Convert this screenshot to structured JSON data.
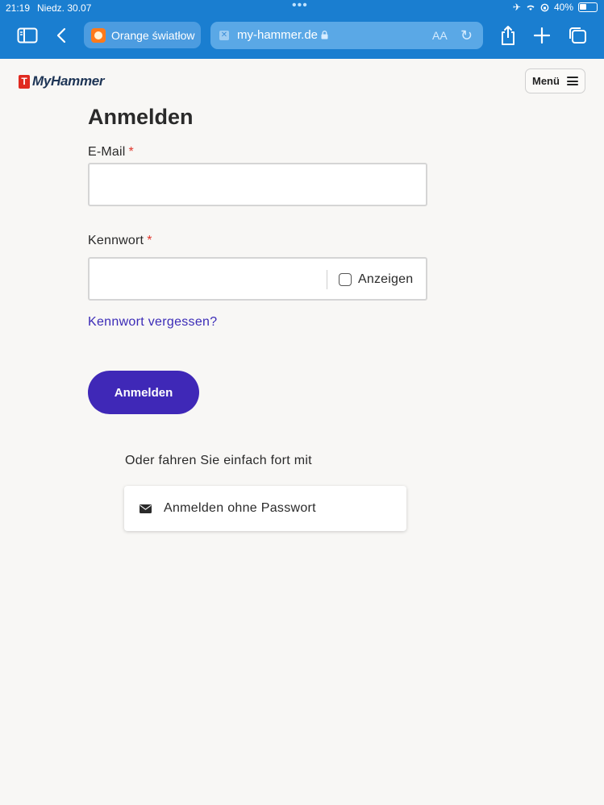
{
  "status_bar": {
    "time": "21:19",
    "date": "Niedz. 30.07",
    "battery": "40%"
  },
  "browser": {
    "tab_title": "Orange światłow",
    "url": "my-hammer.de",
    "text_size_label": "AA"
  },
  "site": {
    "logo_mark": "T",
    "logo_text": "MyHammer",
    "menu_label": "Menü"
  },
  "form": {
    "title": "Anmelden",
    "email_label": "E-Mail",
    "email_value": "",
    "password_label": "Kennwort",
    "password_value": "",
    "required_marker": "*",
    "show_password_label": "Anzeigen",
    "forgot_link": "Kennwort vergessen?",
    "submit_label": "Anmelden",
    "alternative_text": "Oder fahren Sie einfach fort mit",
    "passwordless_label": "Anmelden ohne Passwort"
  },
  "colors": {
    "browser_bar": "#1a7ed0",
    "primary_button": "#3f28b7",
    "link": "#3b2bb7",
    "required": "#e0352b",
    "logo_red": "#e02a20",
    "logo_navy": "#1e3556"
  }
}
